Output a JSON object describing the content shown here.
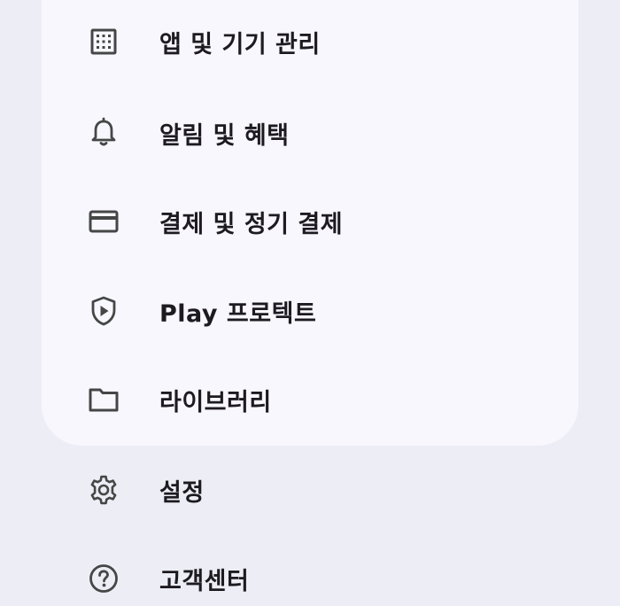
{
  "menu": {
    "items": [
      {
        "label": "앱 및 기기 관리",
        "icon": "apps-grid-icon"
      },
      {
        "label": "알림 및 혜택",
        "icon": "bell-icon"
      },
      {
        "label": "결제 및 정기 결제",
        "icon": "credit-card-icon"
      },
      {
        "label": "Play 프로텍트",
        "icon": "play-protect-shield-icon"
      },
      {
        "label": "라이브러리",
        "icon": "folder-icon"
      },
      {
        "label": "설정",
        "icon": "gear-icon"
      },
      {
        "label": "고객센터",
        "icon": "help-circle-icon"
      }
    ]
  },
  "colors": {
    "background": "#ededf5",
    "card": "#f8f7fd",
    "icon": "#444746",
    "text": "#1d1b20"
  }
}
